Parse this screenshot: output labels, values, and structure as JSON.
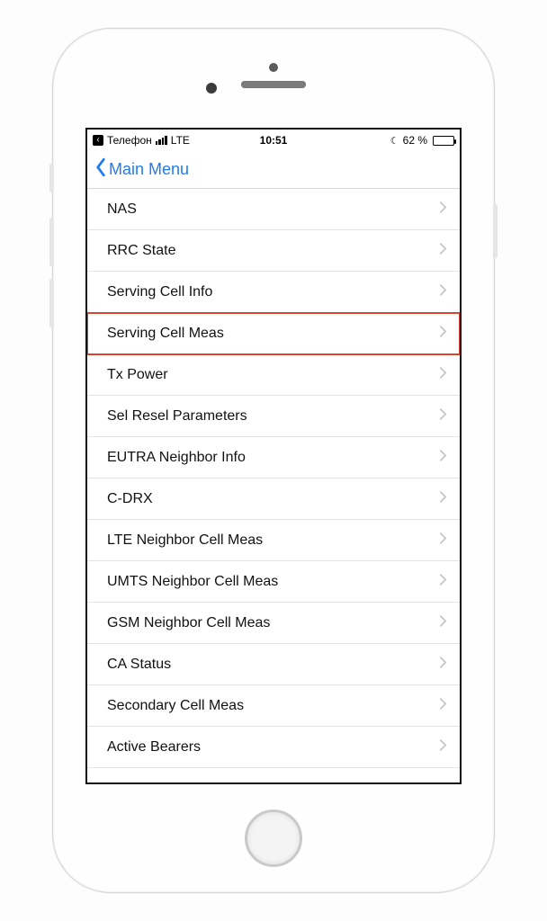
{
  "statusbar": {
    "back_app": "Телефон",
    "network": "LTE",
    "time": "10:51",
    "battery_pct": "62 %"
  },
  "nav": {
    "back_label": "Main Menu"
  },
  "menu": {
    "items": [
      {
        "label": "NAS",
        "highlight": false
      },
      {
        "label": "RRC State",
        "highlight": false
      },
      {
        "label": "Serving Cell Info",
        "highlight": false
      },
      {
        "label": "Serving Cell Meas",
        "highlight": true
      },
      {
        "label": "Tx Power",
        "highlight": false
      },
      {
        "label": "Sel Resel Parameters",
        "highlight": false
      },
      {
        "label": "EUTRA Neighbor Info",
        "highlight": false
      },
      {
        "label": "C-DRX",
        "highlight": false
      },
      {
        "label": "LTE Neighbor Cell Meas",
        "highlight": false
      },
      {
        "label": "UMTS Neighbor Cell Meas",
        "highlight": false
      },
      {
        "label": "GSM Neighbor Cell Meas",
        "highlight": false
      },
      {
        "label": "CA Status",
        "highlight": false
      },
      {
        "label": "Secondary Cell Meas",
        "highlight": false
      },
      {
        "label": "Active Bearers",
        "highlight": false
      }
    ]
  }
}
